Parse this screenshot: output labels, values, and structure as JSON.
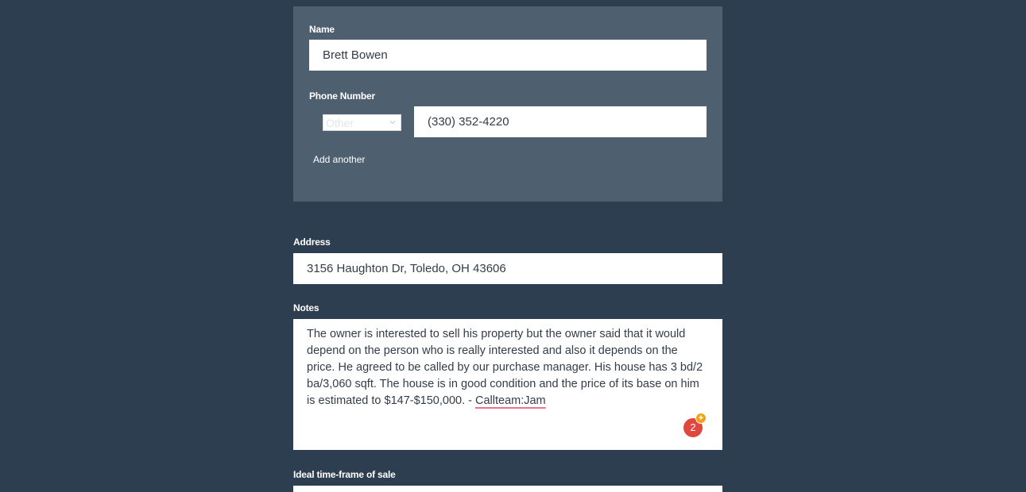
{
  "contact": {
    "name_label": "Name",
    "name_value": "Brett Bowen",
    "phone_label": "Phone Number",
    "phone_type": "Other",
    "phone_value": "(330) 352-4220",
    "add_another": "Add another"
  },
  "address": {
    "label": "Address",
    "value": "3156 Haughton Dr, Toledo, OH 43606"
  },
  "notes": {
    "label": "Notes",
    "text_main": "The owner is interested to sell his property but the owner said that it would depend on the person who is really interested and also it depends on the price. He agreed to be called by our purchase manager. His house has 3 bd/2 ba/3,060 sqft. The house is in good condition and the price of its base on him is estimated to $147-$150,000. - ",
    "text_flagged": "Callteam:Jam",
    "badge_count": "2",
    "badge_plus": "+"
  },
  "timeframe": {
    "label": "Ideal time-frame of sale"
  },
  "colors": {
    "page_bg": "#2d3e50",
    "panel_bg": "#4e5f6f",
    "badge": "#e0473e",
    "badge_plus": "#f2a114"
  }
}
